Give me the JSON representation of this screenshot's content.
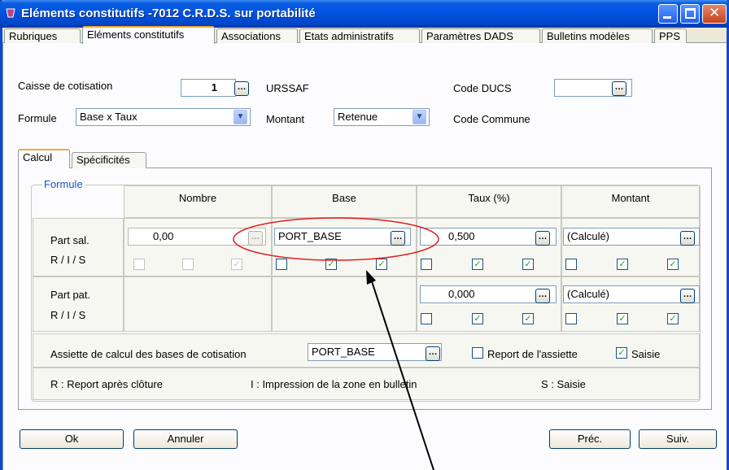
{
  "window": {
    "title": "Eléments constitutifs -7012 C.R.D.S. sur portabilité"
  },
  "tabs": [
    "Rubriques",
    "Eléments constitutifs",
    "Associations",
    "Etats administratifs",
    "Paramètres DADS",
    "Bulletins modèles",
    "PPS"
  ],
  "header": {
    "caisse_label": "Caisse de cotisation",
    "caisse_value": "1",
    "caisse_name": "URSSAF",
    "code_ducs_label": "Code DUCS",
    "code_ducs_value": "",
    "formule_label": "Formule",
    "formule_value": "Base x Taux",
    "montant_label": "Montant",
    "montant_value": "Retenue",
    "code_commune_label": "Code Commune"
  },
  "subtabs": [
    "Calcul",
    "Spécificités"
  ],
  "formule": {
    "group_label": "Formule",
    "columns": [
      "Nombre",
      "Base",
      "Taux (%)",
      "Montant"
    ],
    "part_sal": {
      "label": "Part sal.",
      "nombre": "0,00",
      "base": "PORT_BASE",
      "taux": "0,500",
      "montant": "(Calculé)"
    },
    "part_pat": {
      "label": "Part pat.",
      "taux": "0,000",
      "montant": "(Calculé)"
    },
    "ris_label": "R / I / S",
    "assiette_label": "Assiette de calcul des bases de cotisation",
    "assiette_value": "PORT_BASE",
    "report_label": "Report de l'assiette",
    "saisie_label": "Saisie",
    "legend_r": "R : Report après clôture",
    "legend_i": "I : Impression de la zone en bulletin",
    "legend_s": "S : Saisie"
  },
  "buttons": {
    "ok": "Ok",
    "annuler": "Annuler",
    "prec": "Préc.",
    "suiv": "Suiv."
  },
  "icons": {
    "ellipsis": "…",
    "check": "✓",
    "dropdown": "▼",
    "minimize": "–",
    "maximize": "□",
    "close": "✕"
  },
  "colors": {
    "title_bar": "#0054e3",
    "tab_highlight": "#f7a73b",
    "check_green": "#21a121",
    "annotation_red": "#e02020"
  }
}
